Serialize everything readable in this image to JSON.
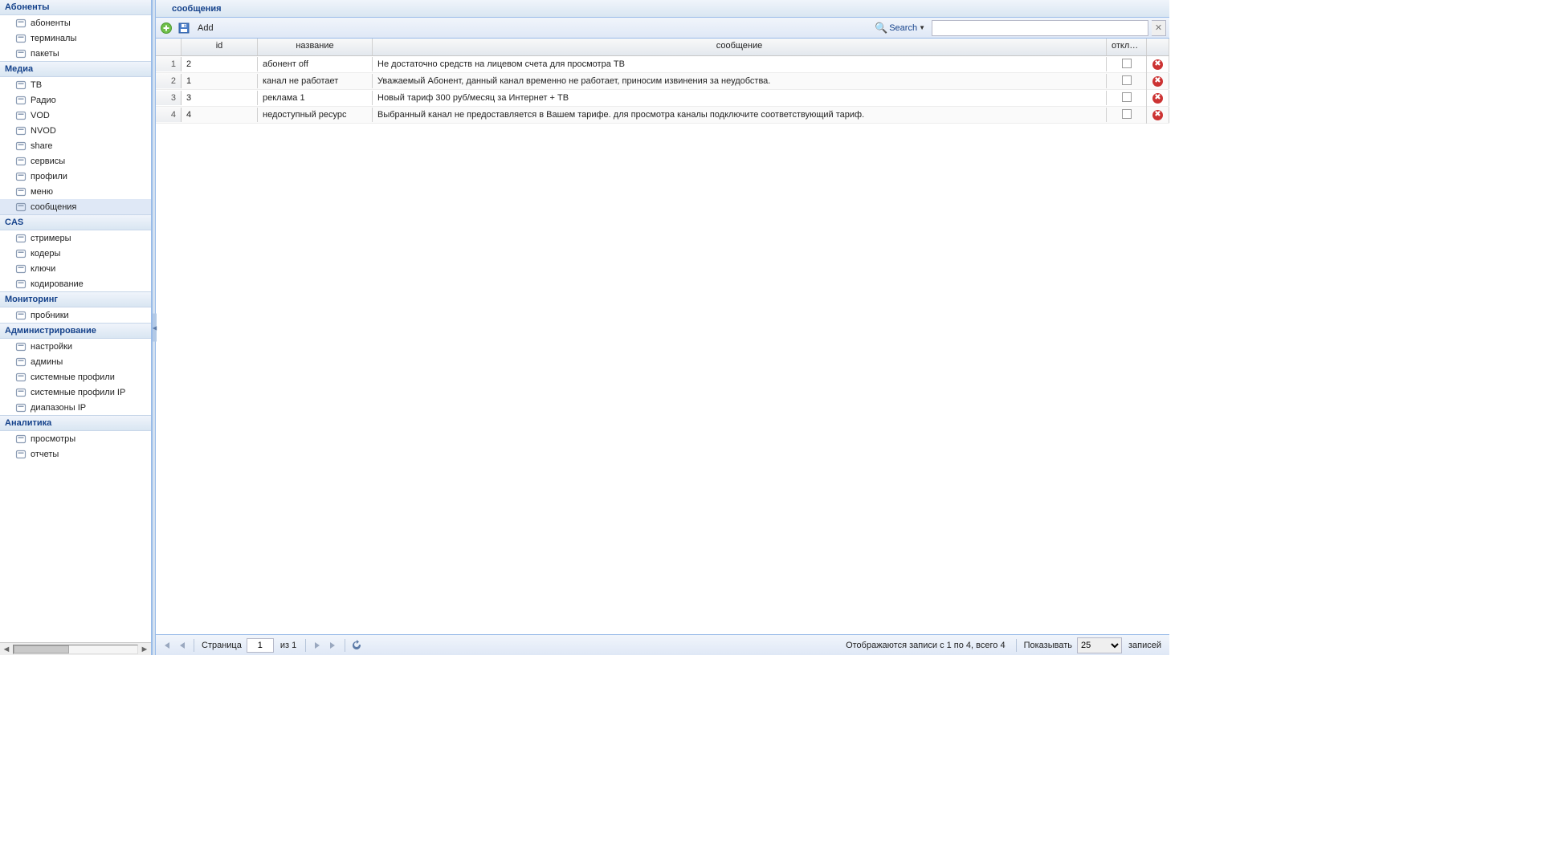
{
  "sidebar": {
    "groups": [
      {
        "title": "Абоненты",
        "items": [
          {
            "label": "абоненты",
            "icon": "users-icon"
          },
          {
            "label": "терминалы",
            "icon": "terminal-icon"
          },
          {
            "label": "пакеты",
            "icon": "folder-icon"
          }
        ]
      },
      {
        "title": "Медиа",
        "items": [
          {
            "label": "ТВ",
            "icon": "tv-icon"
          },
          {
            "label": "Радио",
            "icon": "radio-icon"
          },
          {
            "label": "VOD",
            "icon": "vod-icon"
          },
          {
            "label": "NVOD",
            "icon": "nvod-icon"
          },
          {
            "label": "share",
            "icon": "share-icon"
          },
          {
            "label": "сервисы",
            "icon": "star-icon"
          },
          {
            "label": "профили",
            "icon": "lock-icon"
          },
          {
            "label": "меню",
            "icon": "menu-icon"
          },
          {
            "label": "сообщения",
            "icon": "message-icon",
            "selected": true
          }
        ]
      },
      {
        "title": "CAS",
        "items": [
          {
            "label": "стримеры",
            "icon": "streamer-icon"
          },
          {
            "label": "кодеры",
            "icon": "coder-icon"
          },
          {
            "label": "ключи",
            "icon": "key-icon"
          },
          {
            "label": "кодирование",
            "icon": "encoding-icon"
          }
        ]
      },
      {
        "title": "Мониторинг",
        "items": [
          {
            "label": "пробники",
            "icon": "probe-icon"
          }
        ]
      },
      {
        "title": "Администрирование",
        "items": [
          {
            "label": "настройки",
            "icon": "settings-icon"
          },
          {
            "label": "админы",
            "icon": "admins-icon"
          },
          {
            "label": "системные профили",
            "icon": "sysprofile-icon"
          },
          {
            "label": "системные профили IP",
            "icon": "sysprofile-ip-icon"
          },
          {
            "label": "диапазоны IP",
            "icon": "ip-range-icon"
          }
        ]
      },
      {
        "title": "Аналитика",
        "items": [
          {
            "label": "просмотры",
            "icon": "views-icon"
          },
          {
            "label": "отчеты",
            "icon": "reports-icon"
          }
        ]
      }
    ]
  },
  "main": {
    "title": "сообщения",
    "toolbar": {
      "add_label": "Add",
      "search_label": "Search",
      "search_value": ""
    },
    "columns": {
      "id": "id",
      "name": "название",
      "msg": "сообщение",
      "off": "отключен"
    },
    "rows": [
      {
        "n": "1",
        "id": "2",
        "name": "абонент off",
        "msg": "Не достаточно средств на лицевом счета для просмотра ТВ"
      },
      {
        "n": "2",
        "id": "1",
        "name": "канал не работает",
        "msg": "Уважаемый Абонент, данный канал временно не работает, приносим извинения за неудобства."
      },
      {
        "n": "3",
        "id": "3",
        "name": "реклама 1",
        "msg": "Новый тариф 300 руб/месяц за Интернет + ТВ"
      },
      {
        "n": "4",
        "id": "4",
        "name": "недоступный ресурс",
        "msg": "Выбранный канал не предоставляется в Вашем тарифе. для просмотра каналы подключите соответствующий тариф."
      }
    ],
    "paging": {
      "page_label": "Страница",
      "page_value": "1",
      "of_label": "из 1",
      "showing": "Отображаются записи с 1 по 4, всего 4",
      "show_label": "Показывать",
      "page_size": "25",
      "records_label": "записей"
    }
  }
}
